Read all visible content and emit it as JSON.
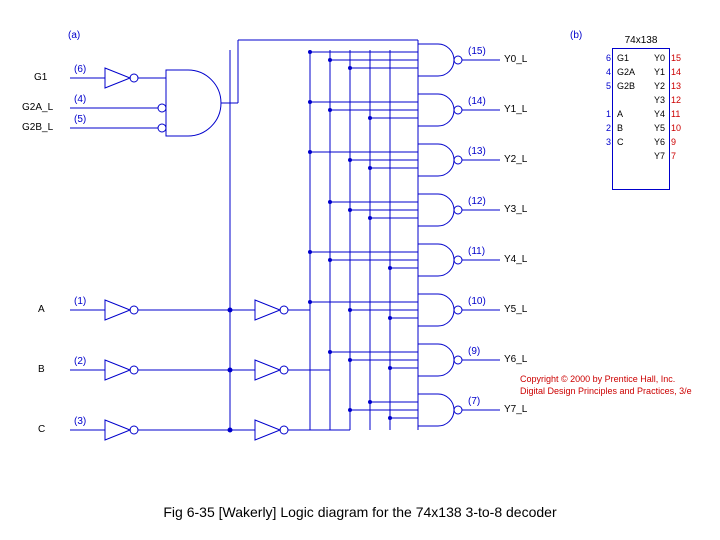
{
  "caption": "Fig 6-35 [Wakerly] Logic diagram for the 74x138 3-to-8 decoder",
  "part_a": "(a)",
  "part_b": "(b)",
  "chip_title": "74x138",
  "copyright1": "Copyright © 2000 by Prentice Hall, Inc.",
  "copyright2": "Digital Design Principles and Practices, 3/e",
  "inputs": {
    "g1": {
      "label": "G1",
      "pin": "(6)"
    },
    "g2a": {
      "label": "G2A_L",
      "pin": "(4)"
    },
    "g2b": {
      "label": "G2B_L",
      "pin": "(5)"
    },
    "a": {
      "label": "A",
      "pin": "(1)"
    },
    "b": {
      "label": "B",
      "pin": "(2)"
    },
    "c": {
      "label": "C",
      "pin": "(3)"
    }
  },
  "outputs": [
    {
      "label": "Y0_L",
      "pin": "(15)"
    },
    {
      "label": "Y1_L",
      "pin": "(14)"
    },
    {
      "label": "Y2_L",
      "pin": "(13)"
    },
    {
      "label": "Y3_L",
      "pin": "(12)"
    },
    {
      "label": "Y4_L",
      "pin": "(11)"
    },
    {
      "label": "Y5_L",
      "pin": "(10)"
    },
    {
      "label": "Y6_L",
      "pin": "(9)"
    },
    {
      "label": "Y7_L",
      "pin": "(7)"
    }
  ],
  "chip_left": [
    {
      "pin": "6",
      "lbl": "G1"
    },
    {
      "pin": "4",
      "lbl": "G2A"
    },
    {
      "pin": "5",
      "lbl": "G2B"
    },
    {
      "pin": "1",
      "lbl": "A"
    },
    {
      "pin": "2",
      "lbl": "B"
    },
    {
      "pin": "3",
      "lbl": "C"
    }
  ],
  "chip_right": [
    {
      "pin": "15",
      "lbl": "Y0"
    },
    {
      "pin": "14",
      "lbl": "Y1"
    },
    {
      "pin": "13",
      "lbl": "Y2"
    },
    {
      "pin": "12",
      "lbl": "Y3"
    },
    {
      "pin": "11",
      "lbl": "Y4"
    },
    {
      "pin": "10",
      "lbl": "Y5"
    },
    {
      "pin": "9",
      "lbl": "Y6"
    },
    {
      "pin": "7",
      "lbl": "Y7"
    }
  ]
}
